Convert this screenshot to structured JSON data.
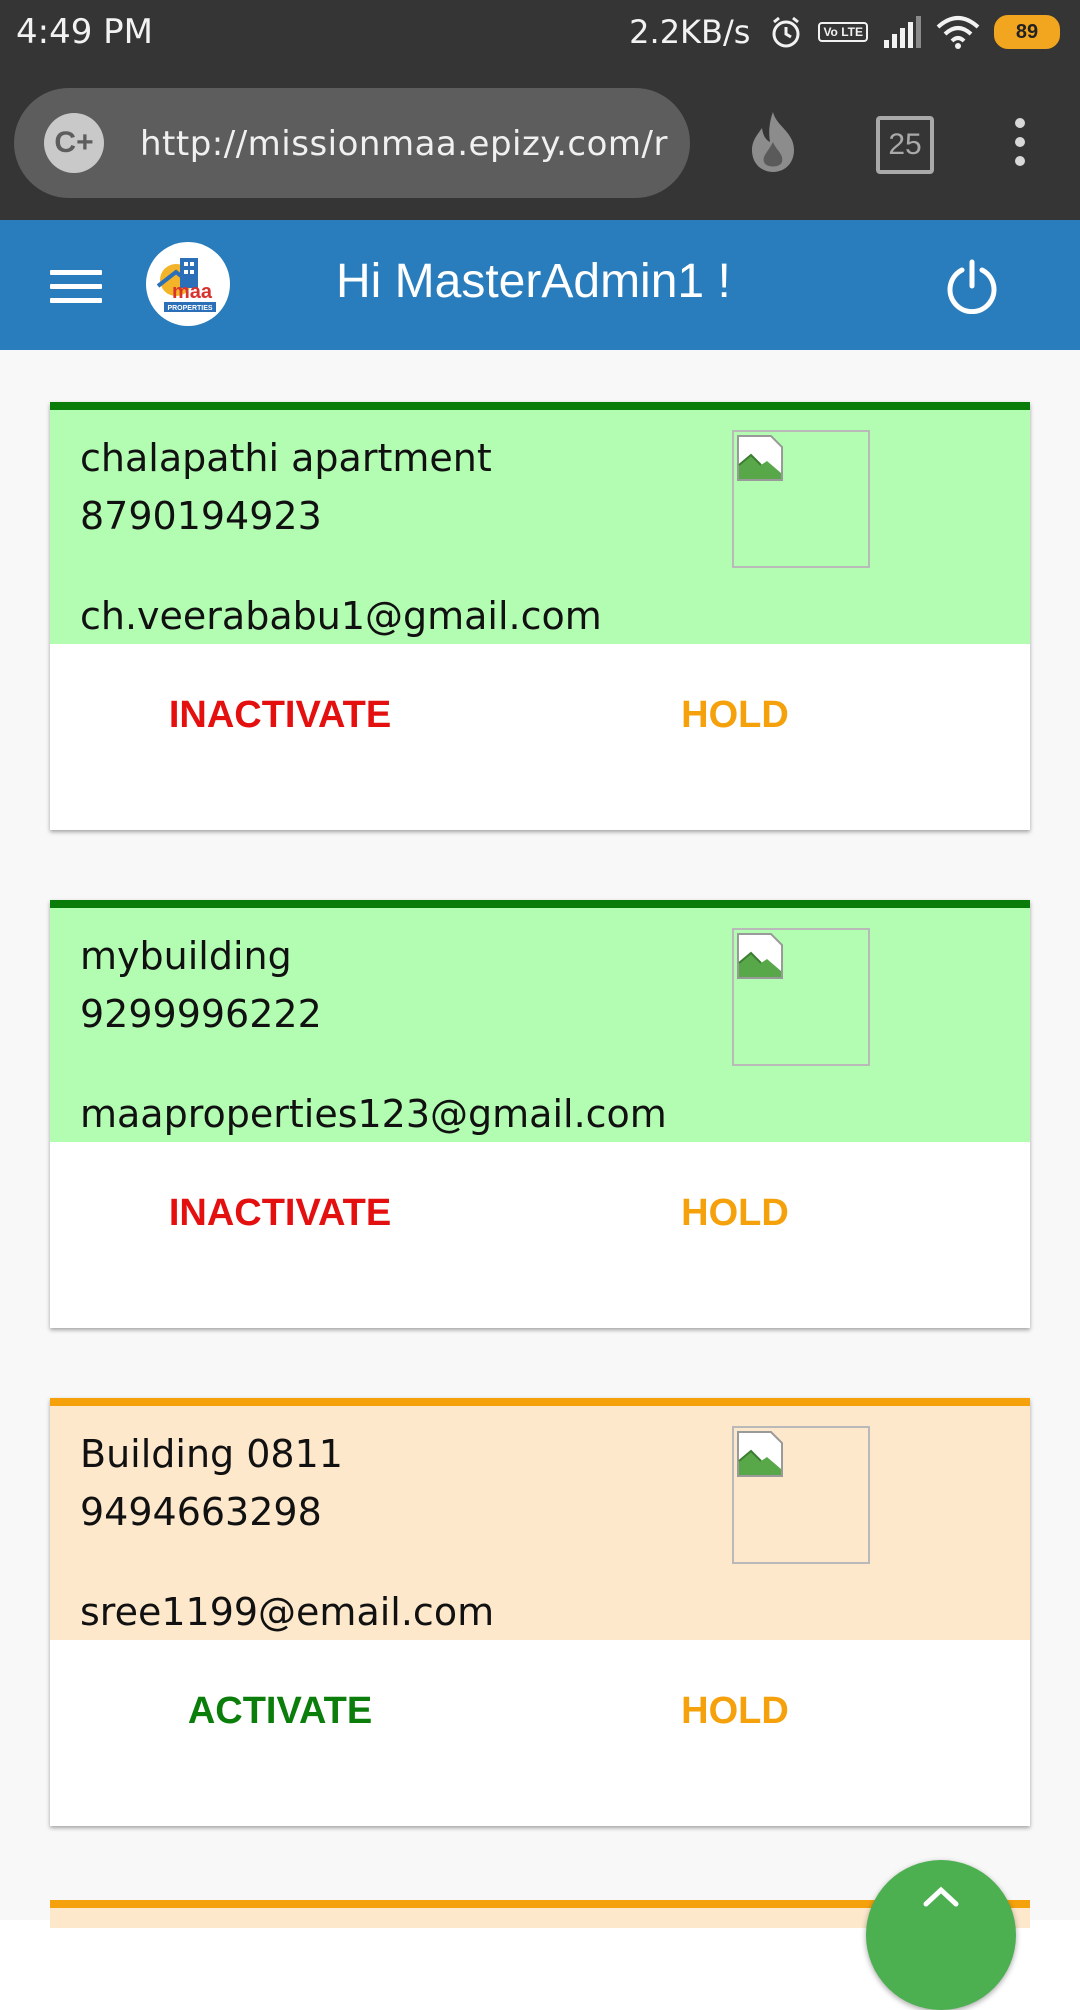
{
  "status_bar": {
    "time": "4:49 PM",
    "speed": "2.2KB/s",
    "volte": "Vo LTE",
    "battery": "89"
  },
  "browser": {
    "url": "http://missionmaa.epizy.com/r",
    "site_icon": "C+",
    "tabs_count": "25"
  },
  "header": {
    "title": "Hi MasterAdmin1 !"
  },
  "colors": {
    "header_blue": "#2a7dbd",
    "active_green": "#b3fdb3",
    "pending_orange": "#fde8cc",
    "inactivate_red": "#e41010",
    "activate_green": "#0b7d0b",
    "hold_orange": "#f5a10c"
  },
  "cards": [
    {
      "name": "chalapathi apartment",
      "phone": "8790194923",
      "email": "ch.veerababu1@gmail.com",
      "primary_action": "INACTIVATE",
      "hold_action": "HOLD",
      "status": "active"
    },
    {
      "name": "mybuilding",
      "phone": "9299996222",
      "email": "maaproperties123@gmail.com",
      "primary_action": "INACTIVATE",
      "hold_action": "HOLD",
      "status": "active"
    },
    {
      "name": "Building 0811",
      "phone": "9494663298",
      "email": "sree1199@email.com",
      "primary_action": "ACTIVATE",
      "hold_action": "HOLD",
      "status": "pending"
    }
  ]
}
